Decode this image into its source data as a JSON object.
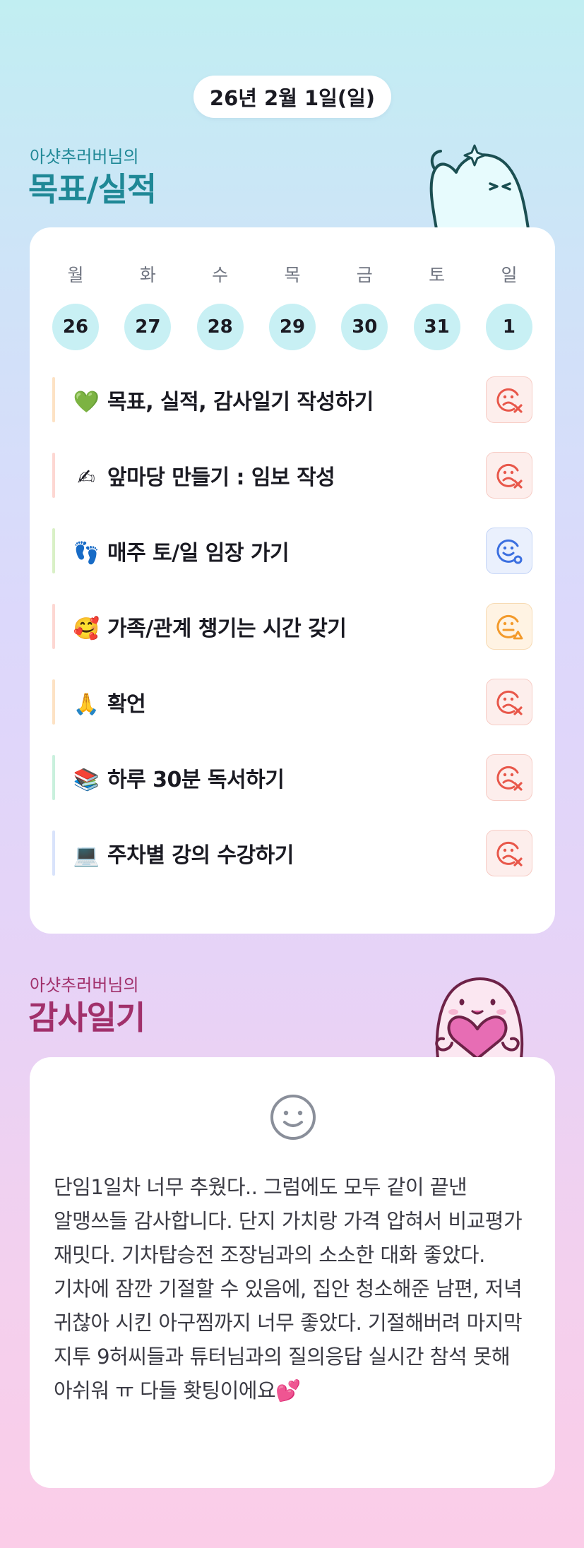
{
  "header": {
    "date": "26년 2월 1일(일)"
  },
  "goals_section": {
    "subtitle": "아샷추러버님의",
    "title": "목표/실적"
  },
  "week": {
    "weekdays": [
      "월",
      "화",
      "수",
      "목",
      "금",
      "토",
      "일"
    ],
    "days": [
      "26",
      "27",
      "28",
      "29",
      "30",
      "31",
      "1"
    ]
  },
  "goals": [
    {
      "icon": "green-heart-icon",
      "emoji": "💚",
      "label": "목표, 실적, 감사일기 작성하기",
      "bar_color": "#fde2c4",
      "status": "bad",
      "status_icon": "sad-face-x-icon"
    },
    {
      "icon": "writing-hand-icon",
      "emoji": "✍",
      "label": "앞마당 만들기 : 임보 작성",
      "bar_color": "#fdd7d2",
      "status": "bad",
      "status_icon": "sad-face-x-icon"
    },
    {
      "icon": "footprints-icon",
      "emoji": "👣",
      "label": "매주 토/일 임장 가기",
      "bar_color": "#d9f0c6",
      "status": "good",
      "status_icon": "smile-face-o-icon"
    },
    {
      "icon": "smiling-face-hearts-icon",
      "emoji": "🥰",
      "label": "가족/관계 챙기는 시간 갖기",
      "bar_color": "#fdd7d2",
      "status": "meh",
      "status_icon": "neutral-face-triangle-icon"
    },
    {
      "icon": "folded-hands-icon",
      "emoji": "🙏",
      "label": "확언",
      "bar_color": "#fde2c4",
      "status": "bad",
      "status_icon": "sad-face-x-icon"
    },
    {
      "icon": "books-icon",
      "emoji": "📚",
      "label": "하루 30분 독서하기",
      "bar_color": "#c9f0dd",
      "status": "bad",
      "status_icon": "sad-face-x-icon"
    },
    {
      "icon": "laptop-icon",
      "emoji": "💻",
      "label": "주차별 강의 수강하기",
      "bar_color": "#d9e3fb",
      "status": "bad",
      "status_icon": "sad-face-x-icon"
    }
  ],
  "diary_section": {
    "subtitle": "아샷추러버님의",
    "title": "감사일기"
  },
  "diary": {
    "mood_icon": "smiley-face-icon",
    "text": "단임1일차 너무 추웠다.. 그럼에도 모두 같이 끝낸 알맹쓰들 감사합니다. 단지 가치랑 가격 압혀서 비교평가 재밋다. 기차탑승전 조장님과의 소소한 대화 좋았다.\n기차에 잠깐 기절할 수 있음에, 집안 청소해준 남편, 저녁 귀찮아 시킨 아구찜까지 너무 좋았다. 기절해버려 마지막 지투 9허씨들과 튜터님과의 질의응답 실시간 참석 못해 아쉬워 ㅠ  다들 홧팅이에요💕"
  },
  "colors": {
    "teal_title": "#1f8896",
    "magenta_title": "#a1306b",
    "bad": "#e8574a",
    "good": "#3b6fe0",
    "meh": "#f39a2b"
  }
}
